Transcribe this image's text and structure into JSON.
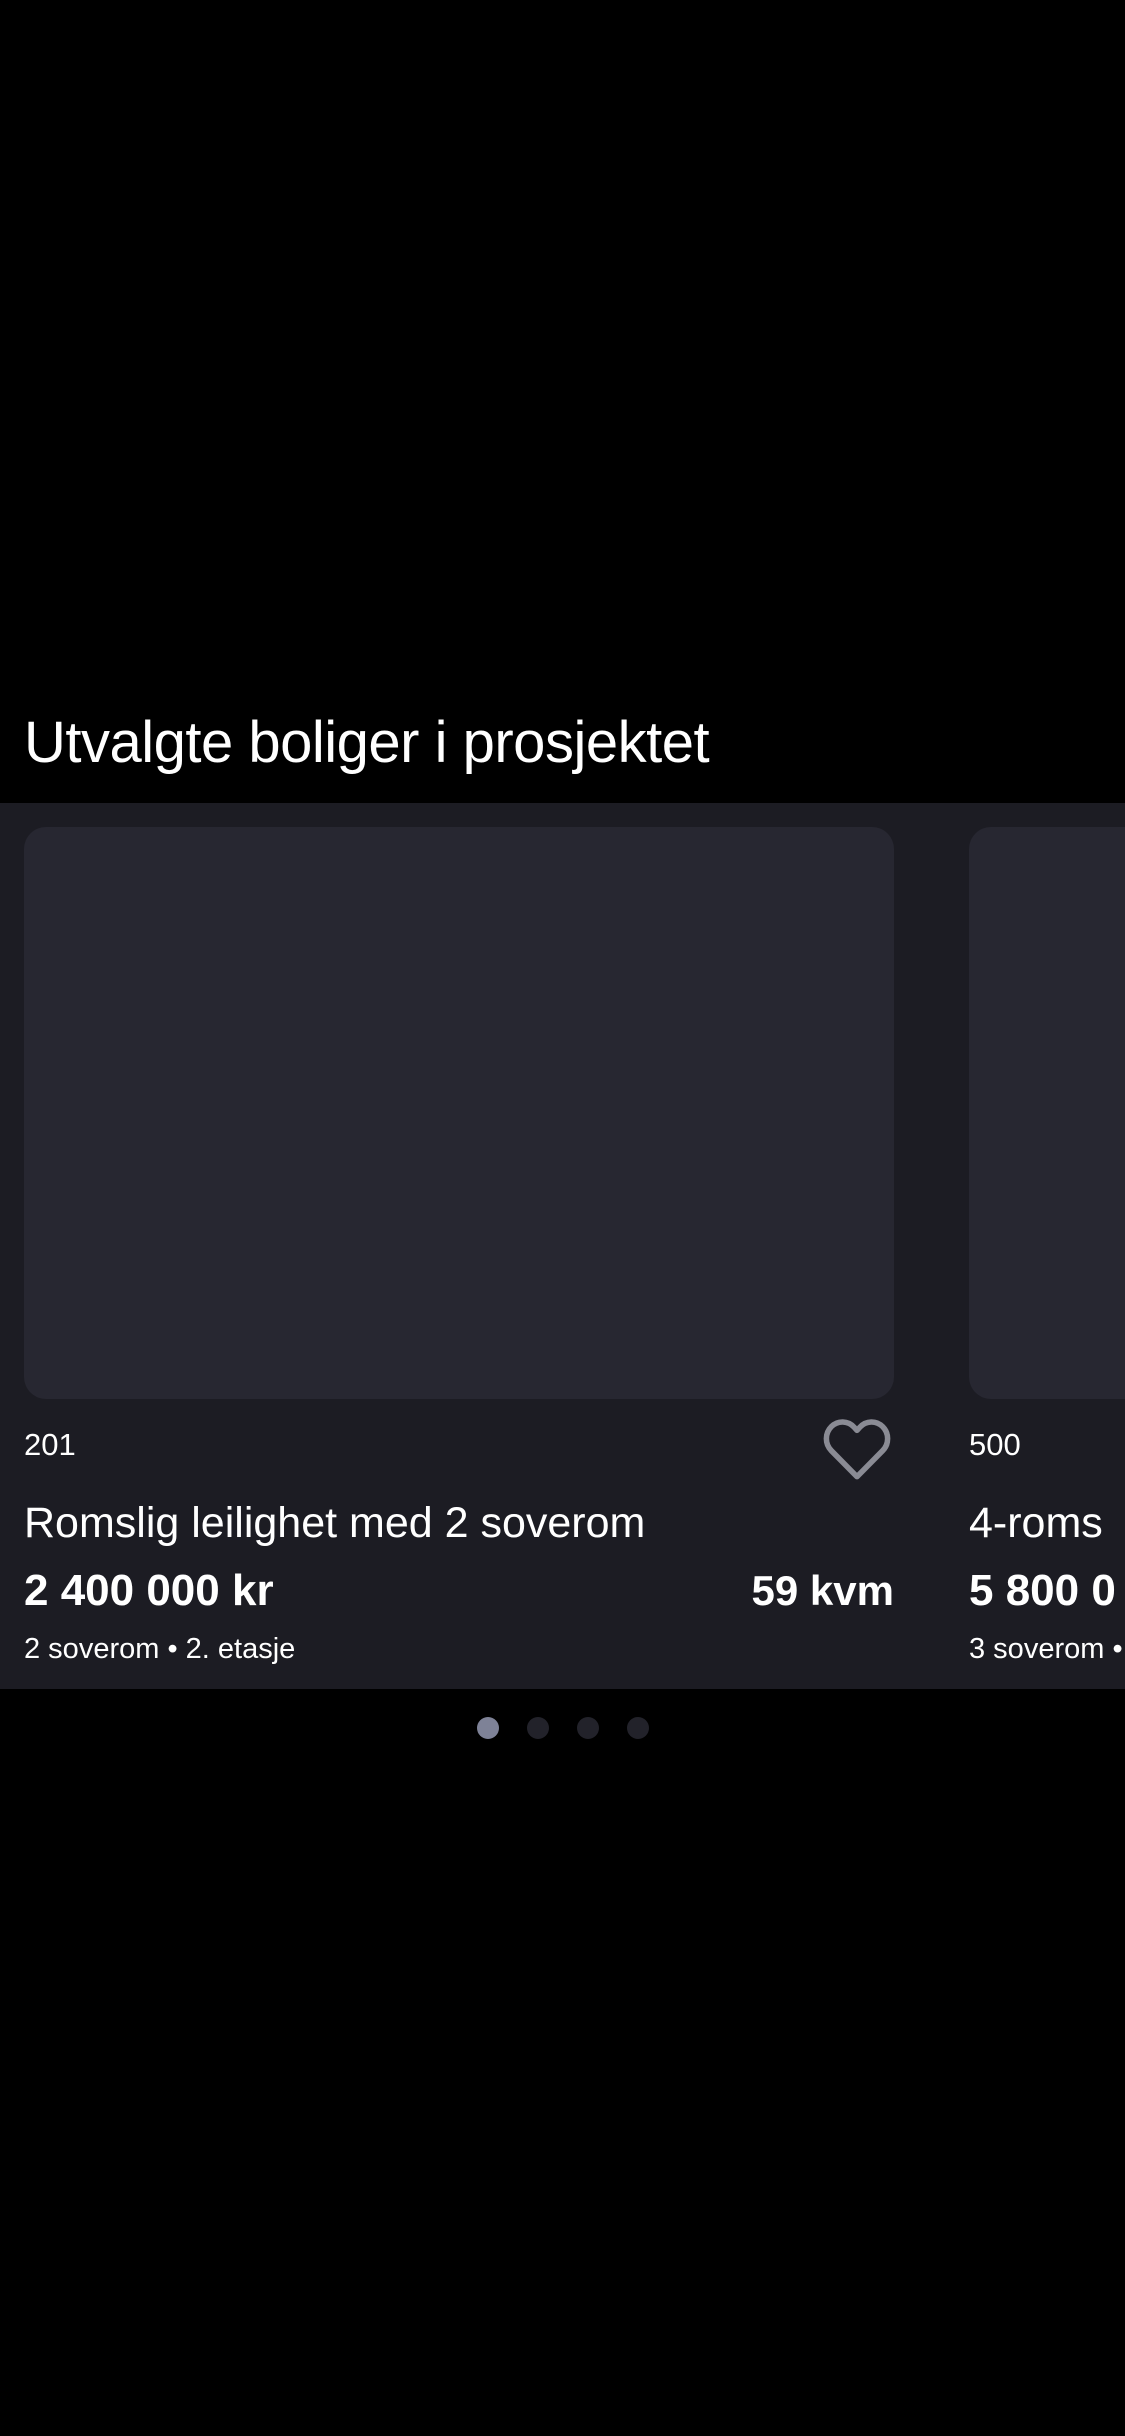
{
  "section": {
    "title": "Utvalgte boliger i prosjektet"
  },
  "listings": [
    {
      "unit": "201",
      "title": "Romslig leilighet med 2 soverom",
      "price": "2 400 000 kr",
      "area": "59 kvm",
      "details": "2 soverom • 2. etasje",
      "favorite_icon": "heart-outline-icon"
    },
    {
      "unit": "500",
      "title": "4-roms",
      "price": "5 800 0",
      "details": "3 soverom •"
    }
  ],
  "pagination": {
    "pages": 4,
    "active_index": 0,
    "active_color": "#7e8297",
    "inactive_color": "#22222a"
  },
  "colors": {
    "background": "#000000",
    "carousel_background": "#1c1c23",
    "image_placeholder": "#272731",
    "heart_stroke": "#8a8b94"
  }
}
